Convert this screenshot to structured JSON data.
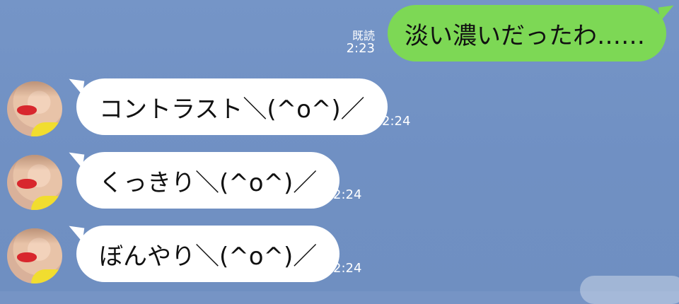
{
  "messages": {
    "outgoing": {
      "read_label": "既読",
      "time": "2:23",
      "text": "淡い濃いだったわ……"
    },
    "incoming": [
      {
        "time": "2:24",
        "text": "コントラスト＼(^o^)／"
      },
      {
        "time": "2:24",
        "text": "くっきり＼(^o^)／"
      },
      {
        "time": "2:24",
        "text": "ぼんやり＼(^o^)／"
      }
    ]
  },
  "colors": {
    "background": "#7694c5",
    "outgoing_bubble": "#7dd855",
    "incoming_bubble": "#ffffff"
  },
  "icons": {
    "avatar": "user-avatar"
  }
}
